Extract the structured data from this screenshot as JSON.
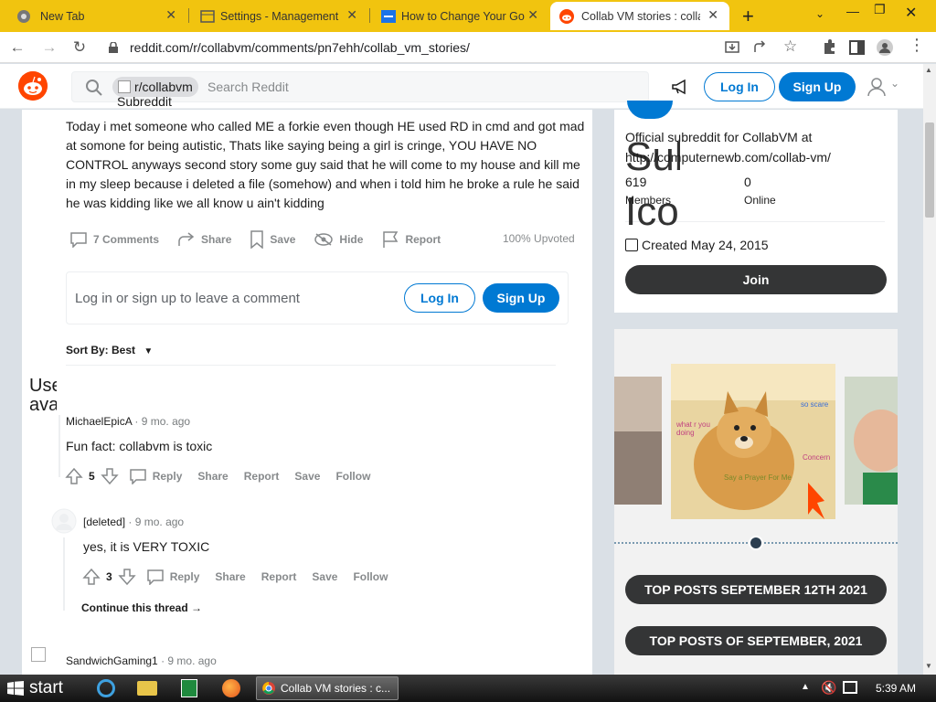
{
  "browser": {
    "tabs": [
      {
        "title": "New Tab",
        "icon": "chrome-icon"
      },
      {
        "title": "Settings - Management",
        "icon": "settings-icon"
      },
      {
        "title": "How to Change Your Go",
        "icon": "page-icon"
      },
      {
        "title": "Collab VM stories : collab",
        "icon": "reddit-icon"
      }
    ],
    "new_tab_symbol": "+",
    "url": "reddit.com/r/collabvm/comments/pn7ehh/collab_vm_stories/"
  },
  "header": {
    "subreddit_chip": "r/collabvm",
    "subreddit_icon_alt": "Subreddit Icon",
    "search_placeholder": "Search Reddit",
    "login_label": "Log In",
    "signup_label": "Sign Up"
  },
  "post": {
    "body": "Today i met someone who called ME a forkie even though HE used RD in cmd and got mad at somone for being autistic, Thats like saying being a girl is cringe, YOU HAVE NO CONTROL anyways second story some guy said that he will come to my house and kill me in my sleep because i deleted a file (somehow) and when i told him he broke a rule he said he was kidding like we all know u ain't kidding",
    "actions": {
      "comments": "7 Comments",
      "share": "Share",
      "save": "Save",
      "hide": "Hide",
      "report": "Report"
    },
    "upvoted": "100% Upvoted"
  },
  "comment_box": {
    "prompt": "Log in or sign up to leave a comment",
    "login_label": "Log In",
    "signup_label": "Sign Up"
  },
  "sort": {
    "label": "Sort By: Best"
  },
  "comments": [
    {
      "avatar_alt": "User avatar",
      "author": "MichaelEpicA",
      "time": "· 9 mo. ago",
      "body": "Fun fact: collabvm is toxic",
      "votes": "5",
      "actions": [
        "Reply",
        "Share",
        "Report",
        "Save",
        "Follow"
      ]
    },
    {
      "author": "[deleted]",
      "time": "· 9 mo. ago",
      "body": "yes, it is VERY TOXIC",
      "votes": "3",
      "actions": [
        "Reply",
        "Share",
        "Report",
        "Save",
        "Follow"
      ],
      "continue": "Continue this thread"
    },
    {
      "author": "SandwichGaming1",
      "time": "· 9 mo. ago"
    }
  ],
  "sidebar": {
    "description": "Official subreddit for CollabVM at http://computernewb.com/collab-vm/",
    "members_value": "619",
    "members_label": "Members",
    "online_value": "0",
    "online_label": "Online",
    "created": "Created May 24, 2015",
    "join_label": "Join",
    "overflow_alt": "Subreddit Icon",
    "meme_texts": {
      "top": "what r you doing",
      "right": "so scare",
      "mid": "Concern",
      "bottom": "Say a Prayer For Me"
    },
    "top_posts_1": "TOP POSTS SEPTEMBER 12TH 2021",
    "top_posts_2": "TOP POSTS OF SEPTEMBER, 2021"
  },
  "taskbar": {
    "start_label": "start",
    "task_label": "Collab VM stories : c...",
    "clock": "5:39 AM"
  },
  "colors": {
    "reddit_orange": "#ff4500",
    "reddit_blue": "#0079d3",
    "tab_bar": "#f1c40f"
  }
}
